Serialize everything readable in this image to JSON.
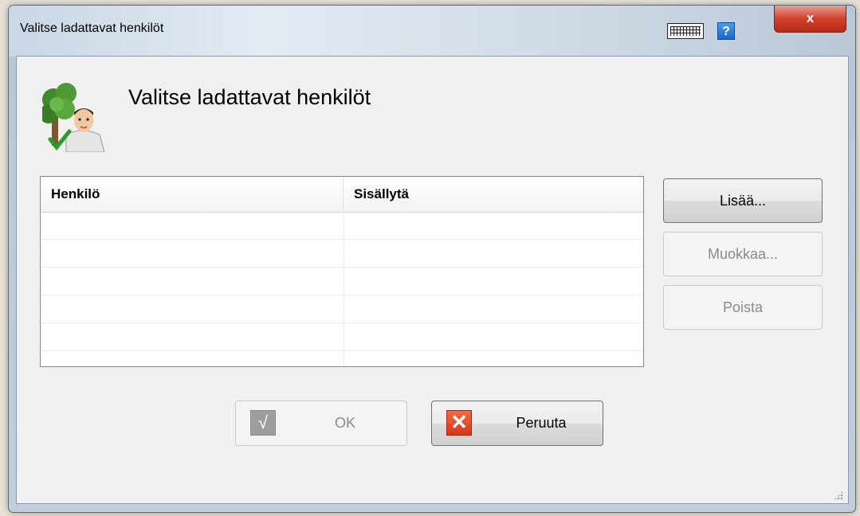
{
  "window": {
    "title": "Valitse ladattavat henkilöt",
    "close_label": "x",
    "help_label": "?"
  },
  "heading": "Valitse ladattavat henkilöt",
  "table": {
    "columns": [
      "Henkilö",
      "Sisällytä"
    ],
    "rows": []
  },
  "buttons": {
    "add": "Lisää...",
    "edit": "Muokkaa...",
    "remove": "Poista",
    "ok": "OK",
    "cancel": "Peruuta",
    "ok_icon": "√",
    "cancel_icon": "✕"
  },
  "icons": {
    "keyboard": "keyboard-icon",
    "help": "help-icon",
    "header": "person-tree-check-icon"
  }
}
